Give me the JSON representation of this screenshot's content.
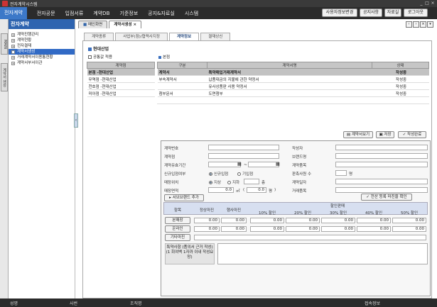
{
  "window": {
    "title": "전자계약시스템"
  },
  "menu": {
    "items": [
      "전자계약",
      "전자공문",
      "입점서류",
      "계약DB",
      "기준정보",
      "공지&자료실",
      "시스템"
    ]
  },
  "header_buttons": {
    "user_info": "사용자정보변경",
    "notice": "공지사항",
    "archive": "자료실",
    "logout": "로그아웃"
  },
  "left_tabs": {
    "main": "MAIN",
    "contract_write": "계약서 생성"
  },
  "sidebar": {
    "title": "전자계약",
    "items": [
      {
        "label": "계약진행관리",
        "toggle": "+"
      },
      {
        "label": "계약현황",
        "toggle": "+"
      },
      {
        "label": "전자결재",
        "toggle": "+"
      },
      {
        "label": "계약서생성",
        "toggle": "−"
      },
      {
        "label": "거래계약서이용통현황",
        "toggle": "+"
      },
      {
        "label": "계약서부서이관",
        "toggle": "+"
      }
    ]
  },
  "doc_tabs": {
    "home": "메인화면",
    "current": "계약서생성"
  },
  "sub_tabs": [
    "계약종류",
    "사업부(점)/협력사지정",
    "계약정보",
    "결재상신"
  ],
  "section": {
    "company": "현대산업",
    "checkbox_label": "공통값 적용",
    "branch_label": "본점"
  },
  "branch_table": {
    "header": "계약점",
    "rows": [
      "본점 -현대산업",
      "무역점 -현대산업",
      "천호점 -현대산업",
      "미아점 -현대산업"
    ]
  },
  "contract_table": {
    "headers": [
      "구분",
      "계약서명",
      "상태"
    ],
    "rows": [
      {
        "type": "계약서",
        "name": "특약매입거래계약서",
        "status": "작성중"
      },
      {
        "type": "부속계약서",
        "name": "납품대금의 지불에 관한 약정서",
        "status": "작성중"
      },
      {
        "type": "",
        "name": "유사상품판 사용 약정서",
        "status": "작성중"
      },
      {
        "type": "첨부문서",
        "name": "도면첨부",
        "status": "작성중"
      }
    ]
  },
  "action_buttons": {
    "view": "계약서보기",
    "save": "저장",
    "complete": "작성완료"
  },
  "form": {
    "contract_no": "계약번호",
    "contract_branch": "계약점",
    "contract_period": "계약유효기간",
    "new_entry": "신규입점여부",
    "entry_options": [
      "신규입점",
      "기입점"
    ],
    "location": "매장위치",
    "floor_options": [
      "지상",
      "지하"
    ],
    "floor_suffix": "층",
    "area": "매장면적",
    "area_value": "0.0",
    "area_unit": "㎡",
    "pyeong_value": "0.0",
    "pyeong_unit": "평",
    "author": "작성자",
    "brand": "브랜드명",
    "item": "계약품목",
    "date": "계약일자",
    "sales_staff": "판촉사원 수",
    "staff_unit": "명",
    "trade_item": "거래품목",
    "brand_add": "서브브랜드 추가",
    "margin_btn": "전산 등록 마진을 확인"
  },
  "margin_table": {
    "headers": [
      "항목",
      "정상마진",
      "행사마진",
      "할인판매"
    ],
    "discount_cols": [
      "10% 할인",
      "20% 할인",
      "30% 할인",
      "40% 할인",
      "50% 할인"
    ],
    "rows": [
      {
        "label": "본매장",
        "values": [
          "0.00",
          "0.00",
          "0.00",
          "0.00",
          "0.00",
          "0.00",
          "0.00"
        ]
      },
      {
        "label": "온라인",
        "values": [
          "0.00",
          "0.00",
          "0.00",
          "0.00",
          "0.00",
          "0.00",
          "0.00"
        ]
      },
      {
        "label": "기타마진",
        "values": []
      }
    ]
  },
  "special_notes": {
    "label": "특약사항 (품의서 근거 작성) (1 회여백 1자까 이내 작성요망)"
  },
  "statusbar": {
    "items": [
      "성명",
      "사번",
      "조직명",
      "접속정보"
    ]
  }
}
